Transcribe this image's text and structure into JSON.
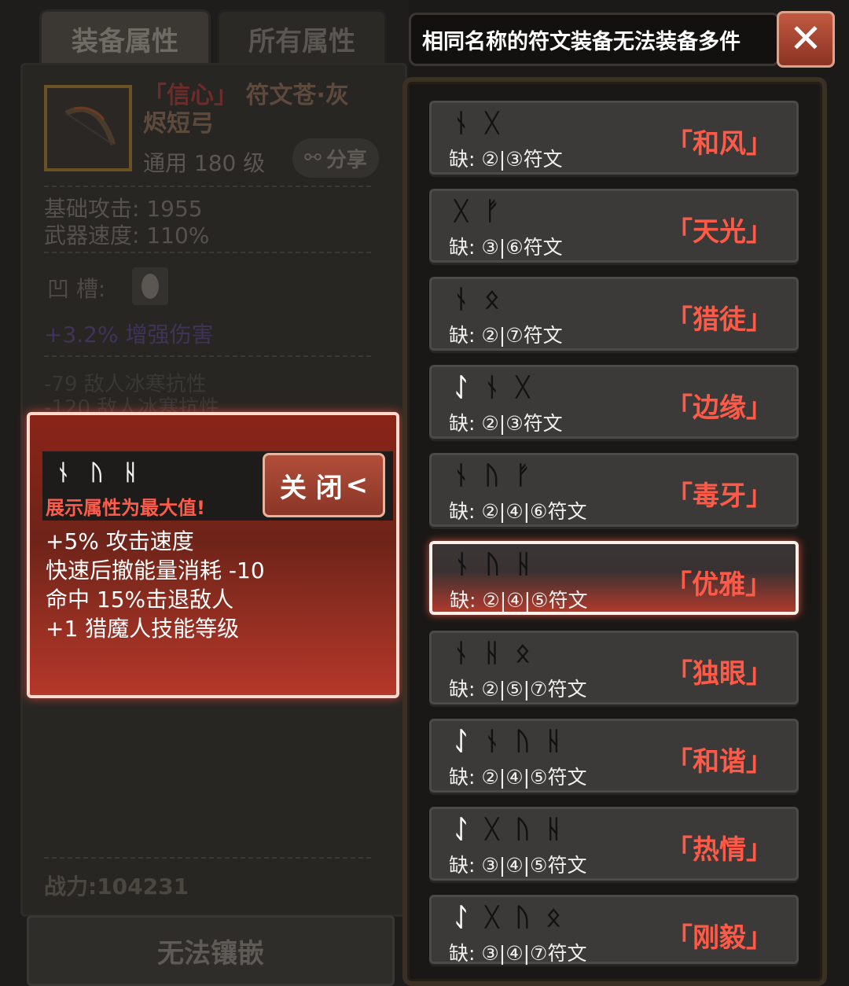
{
  "tabs": {
    "equip": "装备属性",
    "all": "所有属性"
  },
  "item": {
    "name_part1": "「信心」",
    "name_part2": "符文苍·灰",
    "name_line2": "烬短弓",
    "level": "通用  180 级",
    "share": "分享",
    "stats": [
      "基础攻击:  1955",
      "武器速度:  110%"
    ],
    "socket_label": "凹    槽:",
    "socket_bonus": "+3.2% 增强伤害",
    "faint_lines": [
      "-79 敌人冰寒抗性",
      "-120 敌人冰寒抗性"
    ],
    "power": "战力:104231"
  },
  "embed_button": "无法镶嵌",
  "notice": "相同名称的符文装备无法装备多件",
  "close_x": "✕",
  "popup": {
    "runes": "ᚾᚢᚺ",
    "warning": "展示属性为最大值!",
    "close_label": "关 闭",
    "close_arrow": "<",
    "lines": [
      "+5% 攻击速度",
      "快速后撤能量消耗 -10",
      "命中 15%击退敌人",
      "+1 猎魔人技能等级"
    ]
  },
  "runewords": [
    {
      "runes": "ᚾᚷ",
      "white": "",
      "missing": "缺:  ②|③符文",
      "name": "「和风」"
    },
    {
      "runes": "ᚷᚠ",
      "white": "",
      "missing": "缺:  ③|⑥符文",
      "name": "「天光」"
    },
    {
      "runes": "ᚾᛟ",
      "white": "",
      "missing": "缺:  ②|⑦符文",
      "name": "「猎徒」"
    },
    {
      "runes": "ᚾᚷ",
      "white": "ᛇ",
      "missing": "缺:  ②|③符文",
      "name": "「边缘」"
    },
    {
      "runes": "ᚾᚢᚠ",
      "white": "",
      "missing": "缺:  ②|④|⑥符文",
      "name": "「毒牙」"
    },
    {
      "runes": "ᚾᚢᚺ",
      "white": "",
      "missing": "缺:  ②|④|⑤符文",
      "name": "「优雅」"
    },
    {
      "runes": "ᚾᚺᛟ",
      "white": "",
      "missing": "缺:  ②|⑤|⑦符文",
      "name": "「独眼」"
    },
    {
      "runes": "ᚾᚢᚺ",
      "white": "ᛇ",
      "missing": "缺:  ②|④|⑤符文",
      "name": "「和谐」"
    },
    {
      "runes": "ᚷᚢᚺ",
      "white": "ᛇ",
      "missing": "缺:  ③|④|⑤符文",
      "name": "「热情」"
    },
    {
      "runes": "ᚷᚢᛟ",
      "white": "ᛇ",
      "missing": "缺:  ③|④|⑦符文",
      "name": "「刚毅」"
    }
  ]
}
